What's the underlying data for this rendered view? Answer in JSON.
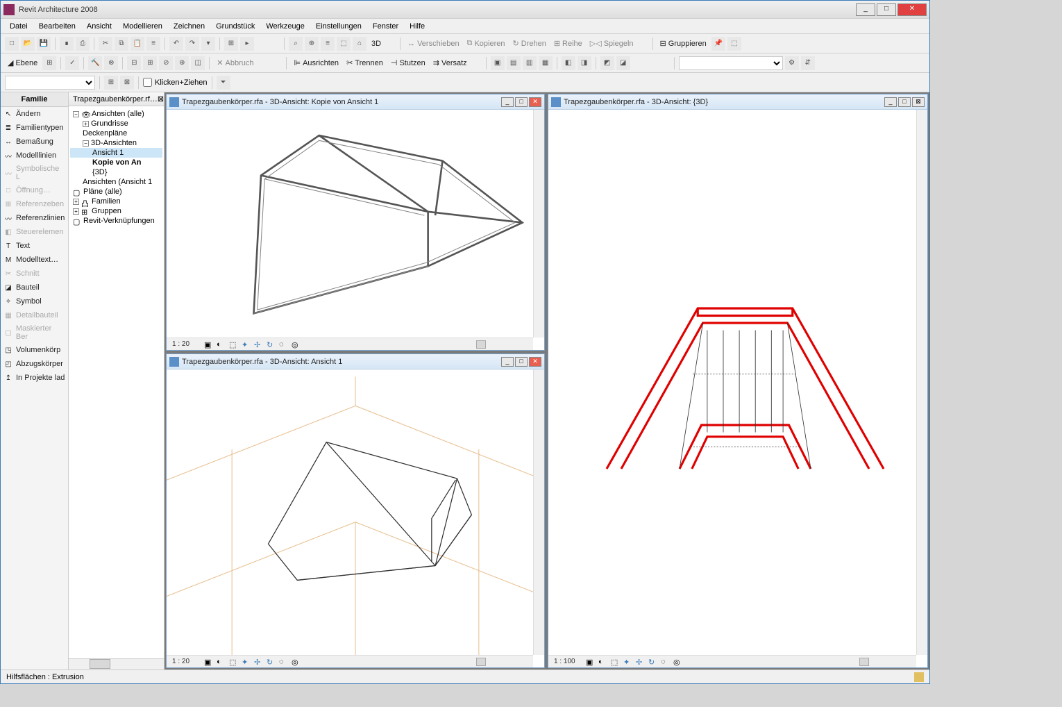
{
  "app": {
    "title": "Revit Architecture 2008"
  },
  "menubar": [
    "Datei",
    "Bearbeiten",
    "Ansicht",
    "Modellieren",
    "Zeichnen",
    "Grundstück",
    "Werkzeuge",
    "Einstellungen",
    "Fenster",
    "Hilfe"
  ],
  "toolbar1_labels": {
    "d3": "3D",
    "move": "Verschieben",
    "copy": "Kopieren",
    "rotate": "Drehen",
    "array": "Reihe",
    "mirror": "Spiegeln",
    "group": "Gruppieren"
  },
  "toolbar2_labels": {
    "ebene": "Ebene",
    "abbruch": "Abbruch",
    "ausrichten": "Ausrichten",
    "trennen": "Trennen",
    "stutzen": "Stutzen",
    "versatz": "Versatz"
  },
  "toolbar3": {
    "click_drag": "Klicken+Ziehen"
  },
  "design_bar": {
    "header": "Familie",
    "items": [
      {
        "k": "andern",
        "label": "Ändern",
        "enabled": true,
        "icn": "↖"
      },
      {
        "k": "familientypen",
        "label": "Familientypen",
        "enabled": true,
        "icn": "≣"
      },
      {
        "k": "bemassung",
        "label": "Bemaßung",
        "enabled": true,
        "icn": "↔"
      },
      {
        "k": "modelllinien",
        "label": "Modelllinien",
        "enabled": true,
        "icn": "〰"
      },
      {
        "k": "symbolische",
        "label": "Symbolische L",
        "enabled": false,
        "icn": "〰"
      },
      {
        "k": "offnung",
        "label": "Öffnung…",
        "enabled": false,
        "icn": "□"
      },
      {
        "k": "refebenen",
        "label": "Referenzeben",
        "enabled": false,
        "icn": "⊞"
      },
      {
        "k": "reflinien",
        "label": "Referenzlinien",
        "enabled": true,
        "icn": "〰"
      },
      {
        "k": "steuerelem",
        "label": "Steuerelemen",
        "enabled": false,
        "icn": "◧"
      },
      {
        "k": "text",
        "label": "Text",
        "enabled": true,
        "icn": "T"
      },
      {
        "k": "modelltext",
        "label": "Modelltext…",
        "enabled": true,
        "icn": "M"
      },
      {
        "k": "schnitt",
        "label": "Schnitt",
        "enabled": false,
        "icn": "✂"
      },
      {
        "k": "bauteil",
        "label": "Bauteil",
        "enabled": true,
        "icn": "◪"
      },
      {
        "k": "symbol",
        "label": "Symbol",
        "enabled": true,
        "icn": "✧"
      },
      {
        "k": "detailbauteil",
        "label": "Detailbauteil",
        "enabled": false,
        "icn": "▦"
      },
      {
        "k": "maskbereich",
        "label": "Maskierter Ber",
        "enabled": false,
        "icn": "▢"
      },
      {
        "k": "volumen",
        "label": "Volumenkörp",
        "enabled": true,
        "icn": "◳"
      },
      {
        "k": "abzug",
        "label": "Abzugskörper",
        "enabled": true,
        "icn": "◰"
      },
      {
        "k": "inprojekte",
        "label": "In Projekte lad",
        "enabled": true,
        "icn": "↥"
      }
    ]
  },
  "browser": {
    "tab": "Trapezgaubenkörper.rf…",
    "nodes": [
      {
        "lvl": 0,
        "exp": "−",
        "icn": "👁",
        "label": "Ansichten (alle)"
      },
      {
        "lvl": 1,
        "exp": "+",
        "label": "Grundrisse"
      },
      {
        "lvl": 1,
        "exp": "",
        "label": "Deckenpläne"
      },
      {
        "lvl": 1,
        "exp": "−",
        "label": "3D-Ansichten"
      },
      {
        "lvl": 2,
        "label": "Ansicht 1",
        "sel": true
      },
      {
        "lvl": 2,
        "label": "Kopie von An",
        "bold": true
      },
      {
        "lvl": 2,
        "label": "{3D}"
      },
      {
        "lvl": 1,
        "exp": "",
        "label": "Ansichten (Ansicht 1"
      },
      {
        "lvl": 0,
        "icn": "▢",
        "label": "Pläne (alle)"
      },
      {
        "lvl": 0,
        "exp": "+",
        "icn": "凸",
        "label": "Familien"
      },
      {
        "lvl": 0,
        "exp": "+",
        "icn": "⊞",
        "label": "Gruppen"
      },
      {
        "lvl": 0,
        "icn": "▢",
        "label": "Revit-Verknüpfungen"
      }
    ]
  },
  "views": {
    "v1": {
      "title": "Trapezgaubenkörper.rfa - 3D-Ansicht: Kopie von Ansicht 1",
      "scale": "1 : 20"
    },
    "v2": {
      "title": "Trapezgaubenkörper.rfa - 3D-Ansicht: Ansicht 1",
      "scale": "1 : 20"
    },
    "v3": {
      "title": "Trapezgaubenkörper.rfa - 3D-Ansicht: {3D}",
      "scale": "1 : 100"
    }
  },
  "status": {
    "text": "Hilfsflächen : Extrusion"
  }
}
